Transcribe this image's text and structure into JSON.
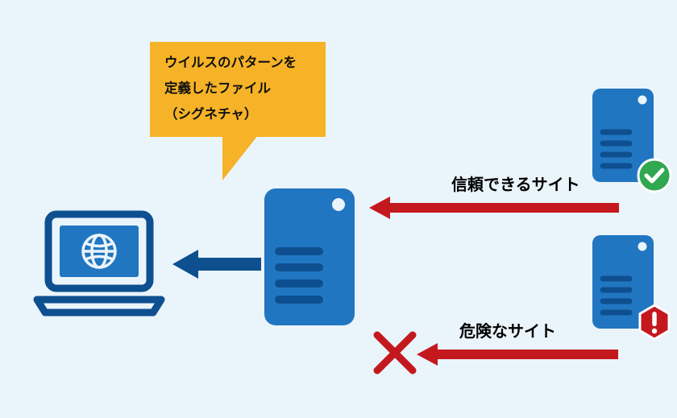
{
  "callout": {
    "line1": "ウイルスのパターンを",
    "line2": "定義したファイル",
    "line3": "（シグネチャ）"
  },
  "labels": {
    "trusted_site": "信頼できるサイト",
    "danger_site": "危険なサイト"
  },
  "colors": {
    "bg": "#eaf4fb",
    "blue_primary": "#2176c1",
    "blue_dark": "#0e4f90",
    "callout": "#f6b327",
    "red": "#c4181f",
    "green": "#2fa84f",
    "white": "#ffffff"
  },
  "diagram": {
    "type": "flow",
    "nodes": [
      {
        "id": "laptop",
        "role": "client",
        "icon": "laptop-with-globe"
      },
      {
        "id": "signature_server",
        "role": "filter",
        "icon": "server",
        "annotation_ref": "callout"
      },
      {
        "id": "trusted_server",
        "role": "source",
        "icon": "server",
        "status": "trusted"
      },
      {
        "id": "danger_server",
        "role": "source",
        "icon": "server",
        "status": "danger"
      }
    ],
    "edges": [
      {
        "from": "signature_server",
        "to": "laptop",
        "style": "blue-arrow",
        "meaning": "delivered"
      },
      {
        "from": "trusted_server",
        "to": "signature_server",
        "style": "red-arrow",
        "label_ref": "labels.trusted_site",
        "meaning": "allowed"
      },
      {
        "from": "danger_server",
        "to": "signature_server",
        "style": "red-arrow",
        "label_ref": "labels.danger_site",
        "meaning": "blocked",
        "blocked": true
      }
    ]
  }
}
